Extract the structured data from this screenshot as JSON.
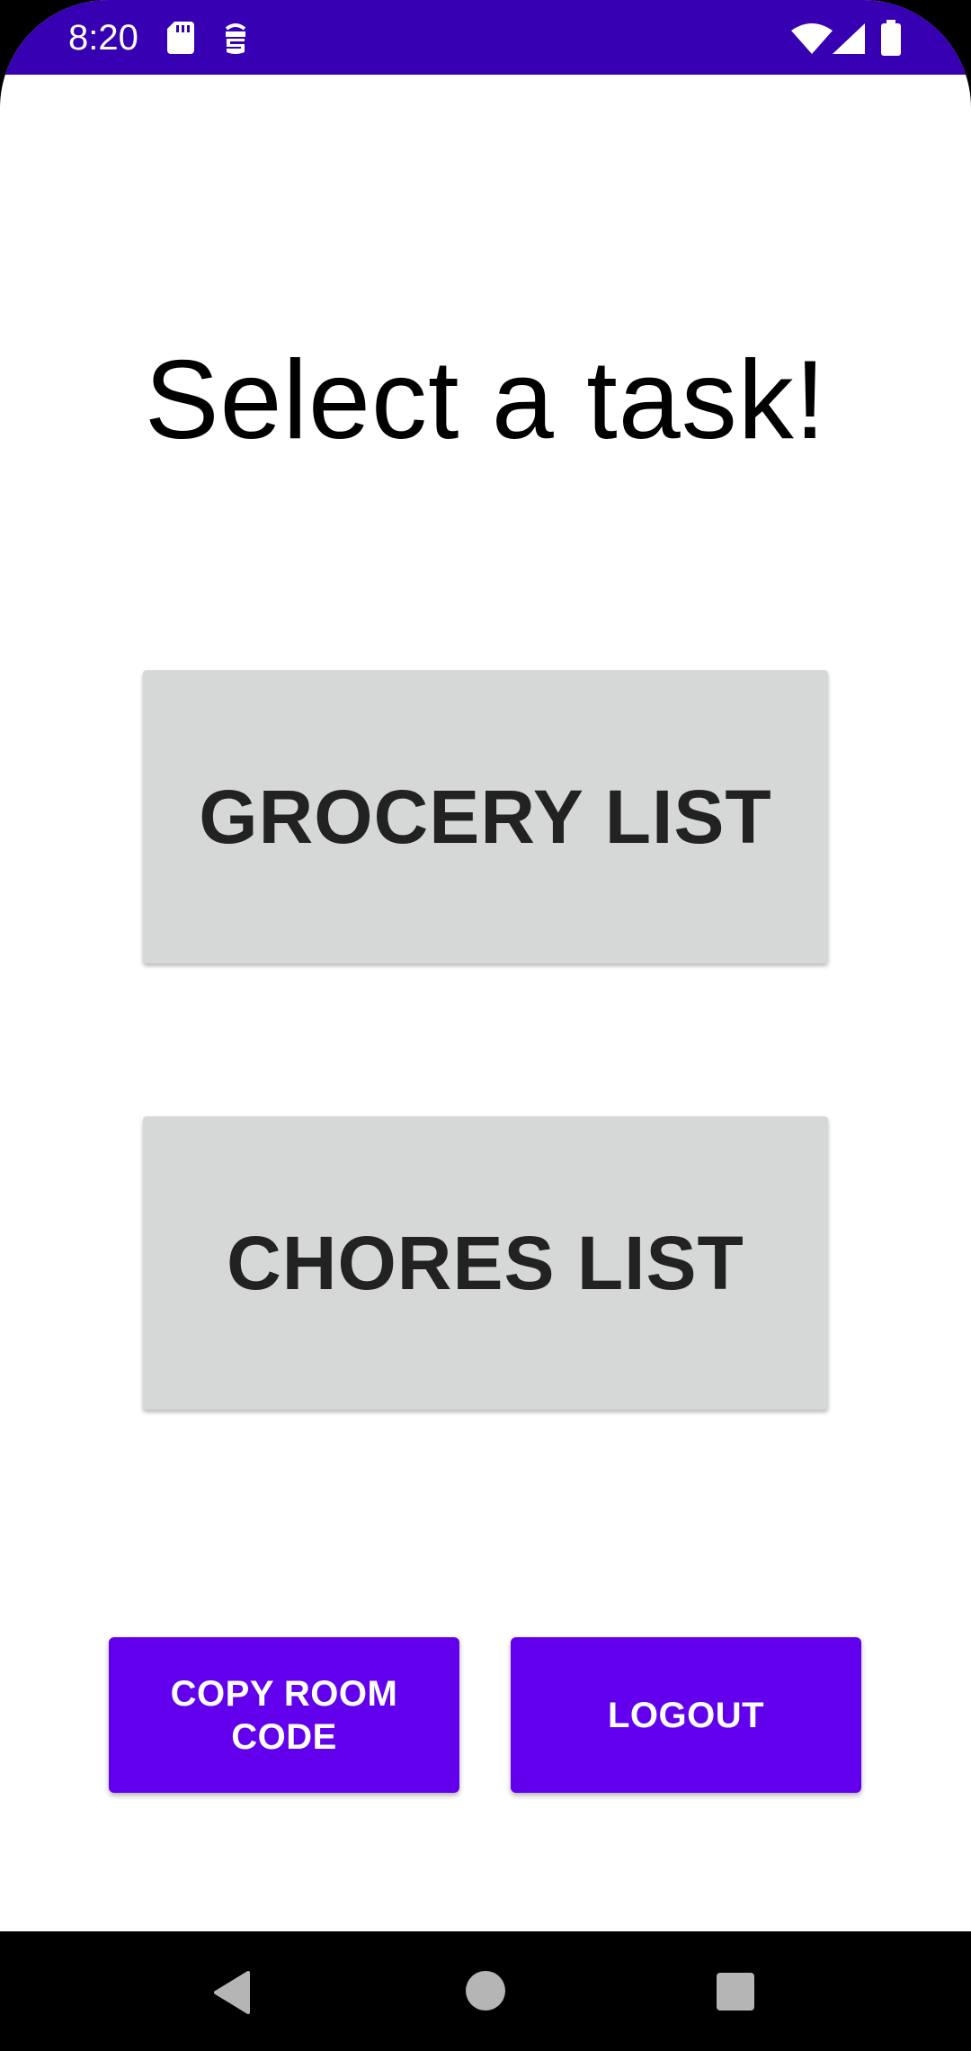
{
  "status_bar": {
    "time": "8:20",
    "icons": [
      "sd-card-icon",
      "robot-icon",
      "wifi-icon",
      "cell-signal-icon",
      "battery-icon"
    ],
    "background": "#3700b3"
  },
  "main": {
    "title": "Select a task!",
    "grocery_button": "GROCERY LIST",
    "chores_button": "CHORES LIST",
    "copy_room_code_button": "COPY ROOM CODE",
    "logout_button": "LOGOUT"
  },
  "colors": {
    "primary": "#6200ee",
    "primary_dark": "#3700b3",
    "task_button": "#d6d7d7"
  },
  "nav_bar": {
    "icons": [
      "back-icon",
      "home-icon",
      "recents-icon"
    ]
  }
}
